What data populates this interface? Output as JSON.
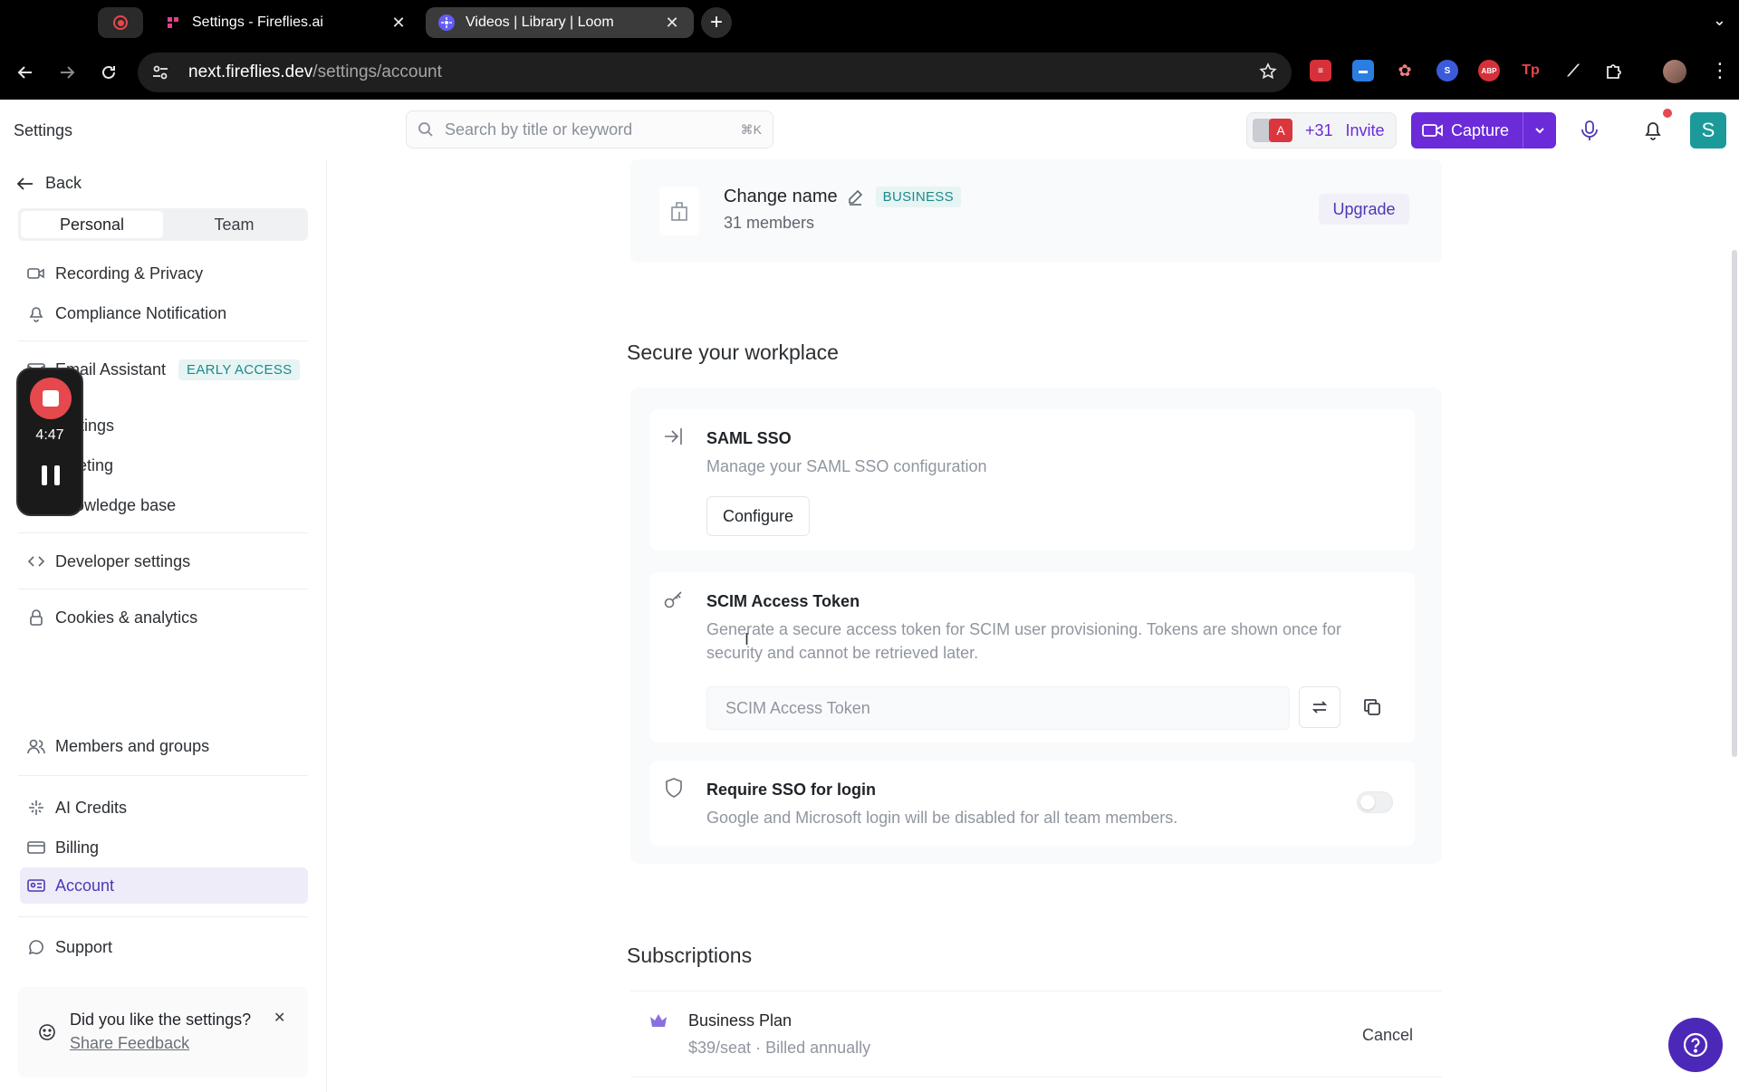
{
  "browser": {
    "tabs": [
      {
        "title": "Settings - Fireflies.ai",
        "close": "✕"
      },
      {
        "title": "Videos | Library | Loom",
        "close": "✕"
      }
    ],
    "url_host": "next.fireflies.dev",
    "url_path": "/settings/account"
  },
  "header": {
    "title": "Settings",
    "search_placeholder": "Search by title or keyword",
    "search_shortcut": "⌘K",
    "avatar_letter_a": "A",
    "member_count": "+31",
    "invite_label": "Invite",
    "capture_label": "Capture",
    "user_initial": "S"
  },
  "sidebar": {
    "back_label": "Back",
    "segments": [
      "Personal",
      "Team"
    ],
    "items": [
      {
        "label": "Recording & Privacy",
        "icon": "video-icon"
      },
      {
        "label": "Compliance Notification",
        "icon": "bell-icon"
      },
      {
        "label": "Email Assistant",
        "icon": "mail-icon",
        "badge": "EARLY ACCESS"
      },
      {
        "label": "Settings",
        "icon": "settings-icon"
      },
      {
        "label": "meeting",
        "icon": "meeting-icon"
      },
      {
        "label": "Knowledge base",
        "icon": "book-icon"
      },
      {
        "label": "Developer settings",
        "icon": "code-icon"
      },
      {
        "label": "Cookies & analytics",
        "icon": "lock-icon"
      },
      {
        "label": "Members and groups",
        "icon": "users-icon"
      },
      {
        "label": "AI Credits",
        "icon": "sparkle-icon"
      },
      {
        "label": "Billing",
        "icon": "card-icon"
      },
      {
        "label": "Account",
        "icon": "id-card-icon"
      },
      {
        "label": "Support",
        "icon": "chat-icon"
      }
    ],
    "feedback": {
      "question": "Did you like the settings?",
      "link": "Share Feedback",
      "close": "✕"
    }
  },
  "recorder": {
    "time": "4:47"
  },
  "org": {
    "name": "Change name",
    "plan_badge": "BUSINESS",
    "members": "31 members",
    "upgrade_label": "Upgrade"
  },
  "secure": {
    "title": "Secure your workplace",
    "saml": {
      "title": "SAML SSO",
      "desc": "Manage your SAML SSO configuration",
      "button": "Configure"
    },
    "scim": {
      "title": "SCIM Access Token",
      "desc": "Generate a secure access token for SCIM user provisioning. Tokens are shown once for security and cannot be retrieved later.",
      "placeholder": "SCIM Access Token"
    },
    "require_sso": {
      "title": "Require SSO for login",
      "desc": "Google and Microsoft login will be disabled for all team members.",
      "enabled": false
    }
  },
  "subscriptions": {
    "title": "Subscriptions",
    "plan_name": "Business Plan",
    "price": "$39/seat",
    "billing": "Billed annually",
    "cancel_label": "Cancel"
  },
  "colors": {
    "accent": "#6b2bd9",
    "teal": "#1c9a99",
    "danger": "#e5484d"
  }
}
